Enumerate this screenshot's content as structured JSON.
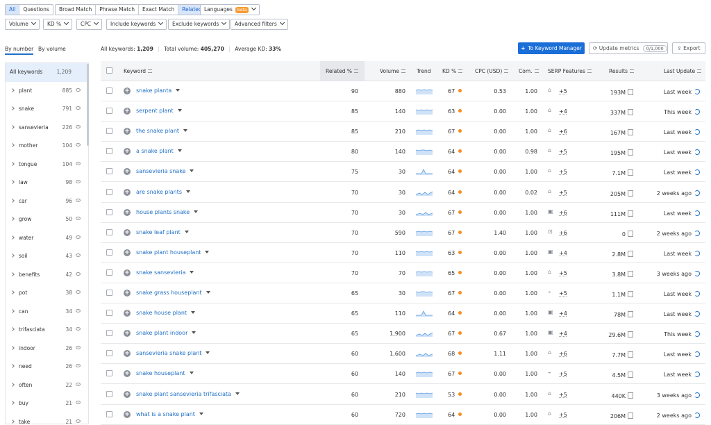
{
  "tabs": [
    "All",
    "Questions"
  ],
  "match_tabs": [
    "Broad Match",
    "Phrase Match",
    "Exact Match",
    "Related"
  ],
  "languages": {
    "label": "Languages",
    "badge": "beta"
  },
  "filters": [
    "Volume",
    "KD %",
    "CPC",
    "Include keywords",
    "Exclude keywords",
    "Advanced filters"
  ],
  "sort_tabs": [
    "By number",
    "By volume"
  ],
  "summary": {
    "all_label": "All keywords:",
    "all_value": "1,209",
    "vol_label": "Total volume:",
    "vol_value": "405,270",
    "kd_label": "Average KD:",
    "kd_value": "33%"
  },
  "actions": {
    "manager": "To Keyword Manager",
    "update": "Update metrics",
    "update_count": "0/1,000",
    "export": "Export"
  },
  "sidebar": [
    {
      "name": "All keywords",
      "count": "1,209"
    },
    {
      "name": "plant",
      "count": "885"
    },
    {
      "name": "snake",
      "count": "791"
    },
    {
      "name": "sansevieria",
      "count": "226"
    },
    {
      "name": "mother",
      "count": "104"
    },
    {
      "name": "tongue",
      "count": "104"
    },
    {
      "name": "law",
      "count": "98"
    },
    {
      "name": "car",
      "count": "96"
    },
    {
      "name": "grow",
      "count": "50"
    },
    {
      "name": "water",
      "count": "49"
    },
    {
      "name": "soil",
      "count": "43"
    },
    {
      "name": "benefits",
      "count": "42"
    },
    {
      "name": "pot",
      "count": "38"
    },
    {
      "name": "can",
      "count": "34"
    },
    {
      "name": "trifasciata",
      "count": "34"
    },
    {
      "name": "indoor",
      "count": "26"
    },
    {
      "name": "need",
      "count": "26"
    },
    {
      "name": "often",
      "count": "22"
    },
    {
      "name": "buy",
      "count": "21"
    },
    {
      "name": "take",
      "count": "21"
    }
  ],
  "columns": [
    "Keyword",
    "Related %",
    "Volume",
    "Trend",
    "KD %",
    "CPC (USD)",
    "Com.",
    "SERP Features",
    "Results",
    "Last Update"
  ],
  "rows": [
    {
      "kw": "snake planta",
      "rel": "90",
      "vol": "880",
      "kd": "67",
      "cpc": "0.53",
      "com": "1.00",
      "sf": "+5",
      "res": "193M",
      "upd": "Last week"
    },
    {
      "kw": "serpent plant",
      "rel": "85",
      "vol": "140",
      "kd": "63",
      "cpc": "0.00",
      "com": "1.00",
      "sf": "+4",
      "res": "337M",
      "upd": "This week"
    },
    {
      "kw": "the snake plant",
      "rel": "85",
      "vol": "210",
      "kd": "67",
      "cpc": "0.00",
      "com": "1.00",
      "sf": "+6",
      "res": "167M",
      "upd": "Last week"
    },
    {
      "kw": "a snake plant",
      "rel": "80",
      "vol": "140",
      "kd": "64",
      "cpc": "0.00",
      "com": "0.98",
      "sf": "+5",
      "res": "195M",
      "upd": "Last week"
    },
    {
      "kw": "sansevieria snake",
      "rel": "75",
      "vol": "30",
      "kd": "64",
      "cpc": "0.00",
      "com": "1.00",
      "sf": "+5",
      "res": "7.1M",
      "upd": "Last week"
    },
    {
      "kw": "are snake plants",
      "rel": "70",
      "vol": "30",
      "kd": "64",
      "cpc": "0.00",
      "com": "0.02",
      "sf": "+5",
      "res": "205M",
      "upd": "2 weeks ago"
    },
    {
      "kw": "house plants snake",
      "rel": "70",
      "vol": "30",
      "kd": "67",
      "cpc": "0.00",
      "com": "1.00",
      "sf": "+6",
      "res": "111M",
      "upd": "Last week"
    },
    {
      "kw": "snake leaf plant",
      "rel": "70",
      "vol": "590",
      "kd": "67",
      "cpc": "1.40",
      "com": "1.00",
      "sf": "+6",
      "res": "0",
      "upd": "2 weeks ago"
    },
    {
      "kw": "snake plant houseplant",
      "rel": "70",
      "vol": "110",
      "kd": "63",
      "cpc": "0.00",
      "com": "1.00",
      "sf": "+4",
      "res": "2.8M",
      "upd": "Last week"
    },
    {
      "kw": "snake sansevieria",
      "rel": "70",
      "vol": "70",
      "kd": "65",
      "cpc": "0.00",
      "com": "1.00",
      "sf": "+5",
      "res": "3.8M",
      "upd": "3 weeks ago"
    },
    {
      "kw": "snake grass houseplant",
      "rel": "65",
      "vol": "30",
      "kd": "67",
      "cpc": "0.00",
      "com": "1.00",
      "sf": "+5",
      "res": "1.1M",
      "upd": "Last week"
    },
    {
      "kw": "snake house plant",
      "rel": "65",
      "vol": "110",
      "kd": "64",
      "cpc": "0.00",
      "com": "1.00",
      "sf": "+4",
      "res": "78M",
      "upd": "Last week"
    },
    {
      "kw": "snake plant indoor",
      "rel": "65",
      "vol": "1,900",
      "kd": "67",
      "cpc": "0.67",
      "com": "1.00",
      "sf": "+4",
      "res": "29.6M",
      "upd": "This week"
    },
    {
      "kw": "sansevieria snake plant",
      "rel": "60",
      "vol": "1,600",
      "kd": "68",
      "cpc": "1.11",
      "com": "1.00",
      "sf": "+6",
      "res": "7.7M",
      "upd": "Last week"
    },
    {
      "kw": "snake houseplant",
      "rel": "60",
      "vol": "140",
      "kd": "67",
      "cpc": "0.00",
      "com": "1.00",
      "sf": "+5",
      "res": "4.5M",
      "upd": "Last week"
    },
    {
      "kw": "snake plant sansevieria trifasciata",
      "rel": "60",
      "vol": "210",
      "kd": "53",
      "cpc": "0.00",
      "com": "1.00",
      "sf": "+5",
      "res": "440K",
      "upd": "3 weeks ago"
    },
    {
      "kw": "what is a snake plant",
      "rel": "60",
      "vol": "720",
      "kd": "64",
      "cpc": "0.00",
      "com": "1.00",
      "sf": "+5",
      "res": "206M",
      "upd": "2 weeks ago"
    }
  ],
  "colors": {
    "accent": "#1f6fc5",
    "kd_dot": "#f88c1f",
    "button_blue": "#1a6ed8"
  }
}
